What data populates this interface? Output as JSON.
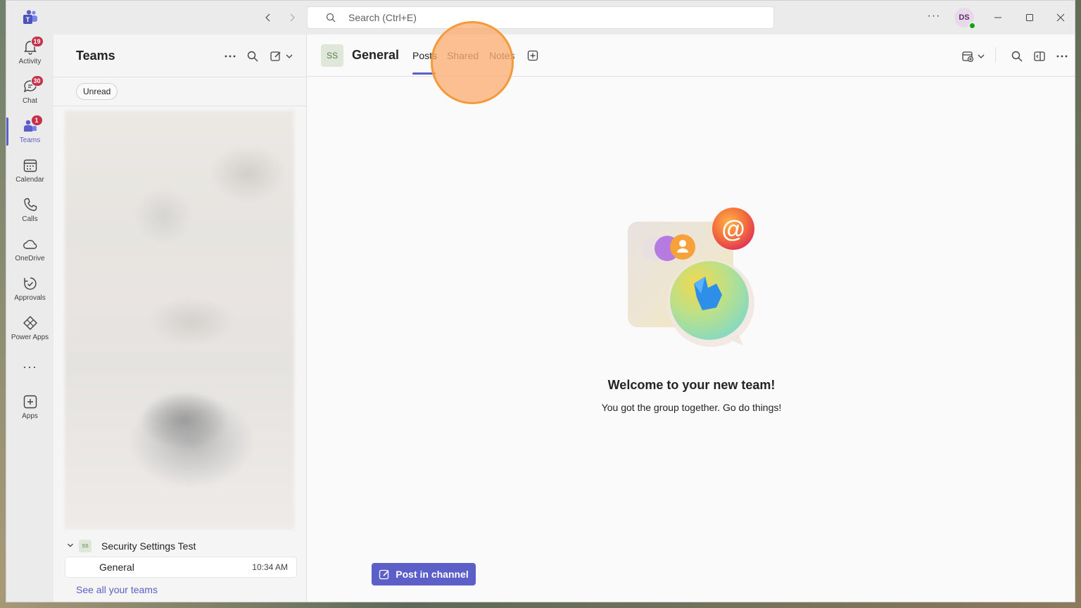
{
  "titlebar": {
    "search_placeholder": "Search (Ctrl+E)",
    "avatar_initials": "DS",
    "more_label": "···"
  },
  "rail": {
    "items": [
      {
        "label": "Activity",
        "badge": "19",
        "icon": "bell-icon"
      },
      {
        "label": "Chat",
        "badge": "30",
        "icon": "chat-icon"
      },
      {
        "label": "Teams",
        "badge": "1",
        "icon": "teams-icon",
        "active": true
      },
      {
        "label": "Calendar",
        "icon": "calendar-icon"
      },
      {
        "label": "Calls",
        "icon": "phone-icon"
      },
      {
        "label": "OneDrive",
        "icon": "cloud-icon"
      },
      {
        "label": "Approvals",
        "icon": "approvals-icon"
      },
      {
        "label": "Power Apps",
        "icon": "power-apps-icon"
      },
      {
        "label": "Apps",
        "icon": "add-app-icon"
      }
    ],
    "more_label": "···"
  },
  "panel": {
    "title": "Teams",
    "filter_chip": "Unread",
    "team": {
      "name": "Security Settings Test",
      "initials": "SS"
    },
    "channel": {
      "name": "General",
      "time": "10:34 AM"
    },
    "see_all": "See all your teams"
  },
  "channel_header": {
    "initials": "SS",
    "title": "General",
    "tabs": [
      {
        "label": "Posts",
        "active": true
      },
      {
        "label": "Shared",
        "active": false
      },
      {
        "label": "Notes",
        "active": false
      }
    ]
  },
  "welcome": {
    "title": "Welcome to your new team!",
    "subtitle": "You got the group together. Go do things!"
  },
  "compose": {
    "post_button": "Post in channel"
  },
  "colors": {
    "accent": "#5b5fc7",
    "badge": "#c4314b",
    "highlight": "#f59a3c"
  }
}
